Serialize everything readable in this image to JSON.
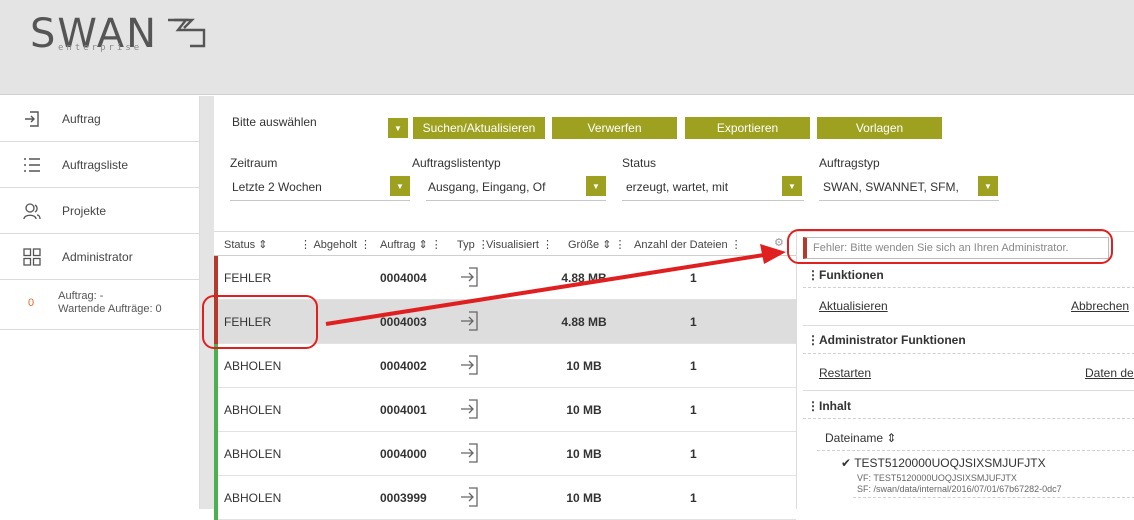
{
  "brand": {
    "name": "SWAN",
    "sub": "enterprise"
  },
  "sidebar": {
    "items": [
      {
        "label": "Auftrag",
        "icon": "login-arrow-icon"
      },
      {
        "label": "Auftragsliste",
        "icon": "list-icon"
      },
      {
        "label": "Projekte",
        "icon": "users-icon"
      },
      {
        "label": "Administrator",
        "icon": "grid-icon"
      }
    ],
    "status": {
      "count": "0",
      "line1": "Auftrag: -",
      "line2": "Wartende Aufträge: 0"
    }
  },
  "filter": {
    "select_label": "Bitte auswählen",
    "buttons": {
      "search": "Suchen/Aktualisieren",
      "discard": "Verwerfen",
      "export": "Exportieren",
      "templates": "Vorlagen"
    },
    "fields": [
      {
        "label": "Zeitraum",
        "value": "Letzte 2 Wochen"
      },
      {
        "label": "Auftragslistentyp",
        "value": "Ausgang, Eingang, Of"
      },
      {
        "label": "Status",
        "value": "erzeugt, wartet, mit"
      },
      {
        "label": "Auftragstyp",
        "value": "SWAN, SWANNET, SFM,"
      }
    ]
  },
  "table": {
    "headers": {
      "status": "Status",
      "picked": "Abgeholt",
      "order": "Auftrag",
      "type": "Typ",
      "visual": "Visualisiert",
      "size": "Größe",
      "files": "Anzahl der Dateien"
    },
    "rows": [
      {
        "status": "FEHLER",
        "order": "0004004",
        "size": "4.88 MB",
        "files": "1",
        "state_color": "#b23b2e"
      },
      {
        "status": "FEHLER",
        "order": "0004003",
        "size": "4.88 MB",
        "files": "1",
        "state_color": "#b23b2e"
      },
      {
        "status": "ABHOLEN",
        "order": "0004002",
        "size": "10 MB",
        "files": "1",
        "state_color": "#4caf50"
      },
      {
        "status": "ABHOLEN",
        "order": "0004001",
        "size": "10 MB",
        "files": "1",
        "state_color": "#4caf50"
      },
      {
        "status": "ABHOLEN",
        "order": "0004000",
        "size": "10 MB",
        "files": "1",
        "state_color": "#4caf50"
      },
      {
        "status": "ABHOLEN",
        "order": "0003999",
        "size": "10 MB",
        "files": "1",
        "state_color": "#4caf50"
      }
    ]
  },
  "detail": {
    "error": "Fehler: Bitte wenden Sie sich an Ihren Administrator.",
    "functions": {
      "title": "Funktionen",
      "refresh": "Aktualisieren",
      "cancel": "Abbrechen"
    },
    "admin": {
      "title": "Administrator Funktionen",
      "restart": "Restarten",
      "data": "Daten des"
    },
    "content": {
      "title": "Inhalt",
      "column": "Dateiname",
      "file_name": "TEST5120000UOQJSIXSMJUFJTX",
      "vf": "VF: TEST5120000UOQJSIXSMJUFJTX",
      "sf": "SF: /swan/data/internal/2016/07/01/67b67282-0dc7"
    }
  },
  "colors": {
    "accent": "#9da11f",
    "error": "#b23b2e",
    "ok": "#4caf50",
    "annotation": "#e02020"
  }
}
